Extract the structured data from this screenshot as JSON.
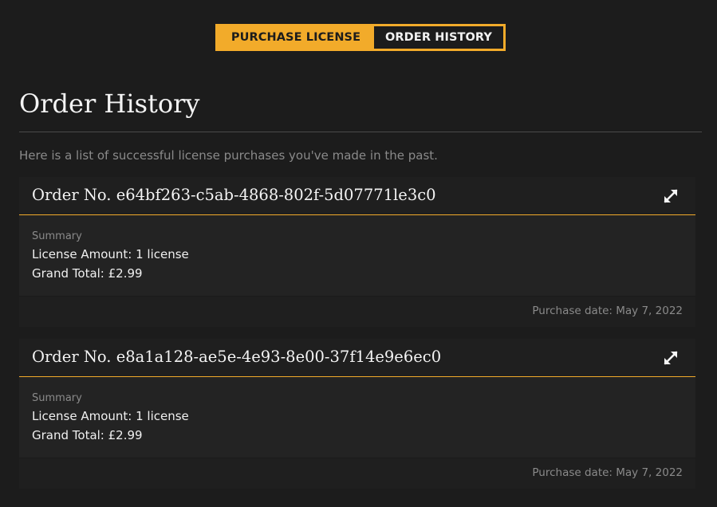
{
  "tabs": {
    "purchase_label": "PURCHASE LICENSE",
    "history_label": "ORDER HISTORY",
    "accent_color": "#f2ab2a"
  },
  "page": {
    "title": "Order History",
    "subtitle": "Here is a list of successful license purchases you've made in the past."
  },
  "orders": [
    {
      "title": "Order No. e64bf263-c5ab-4868-802f-5d07771le3c0",
      "summary_label": "Summary",
      "license_amount": "License Amount: 1 license",
      "grand_total": "Grand Total: £2.99",
      "purchase_date": "Purchase date: May 7, 2022",
      "expand_icon": "expand-icon"
    },
    {
      "title": "Order No. e8a1a128-ae5e-4e93-8e00-37f14e9e6ec0",
      "summary_label": "Summary",
      "license_amount": "License Amount: 1 license",
      "grand_total": "Grand Total: £2.99",
      "purchase_date": "Purchase date: May 7, 2022",
      "expand_icon": "expand-icon"
    }
  ]
}
